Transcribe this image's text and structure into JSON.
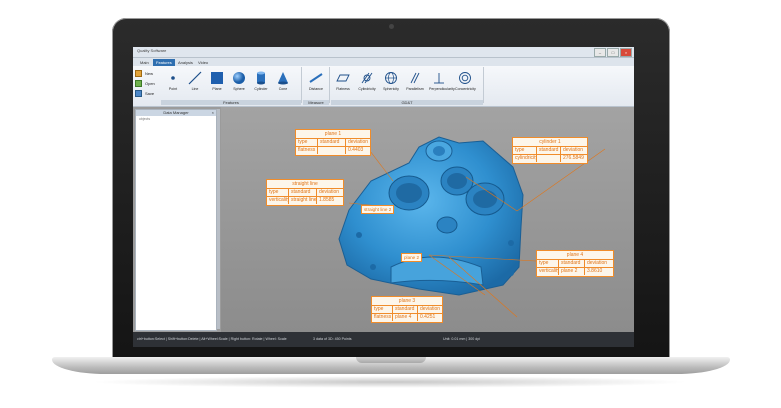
{
  "app": {
    "title": "Quality Software"
  },
  "tabs": [
    {
      "label": "Main"
    },
    {
      "label": "Features"
    },
    {
      "label": "Analysis"
    },
    {
      "label": "Video"
    }
  ],
  "file_menu": [
    {
      "label": "New"
    },
    {
      "label": "Open"
    },
    {
      "label": "Save"
    }
  ],
  "ribbon": {
    "features": {
      "label": "Features",
      "buttons": [
        {
          "label": "Point"
        },
        {
          "label": "Line"
        },
        {
          "label": "Plane"
        },
        {
          "label": "Sphere"
        },
        {
          "label": "Cylinder"
        },
        {
          "label": "Cone"
        }
      ]
    },
    "measure": {
      "label": "Measure",
      "buttons": [
        {
          "label": "Distance"
        }
      ]
    },
    "gdt": {
      "label": "GD&T",
      "buttons": [
        {
          "label": "Flatness"
        },
        {
          "label": "Cylindricity"
        },
        {
          "label": "Sphericity"
        },
        {
          "label": "Parallelism"
        },
        {
          "label": "Perpendicularity"
        },
        {
          "label": "Concentricity"
        }
      ]
    }
  },
  "panel": {
    "title": "Data Manager",
    "subtitle": "objects"
  },
  "status": {
    "left": "ctrl+button:Select | Shift+button:Delete | Alt+Wheel:Scale | Right button: Rotate | Wheel: Scale",
    "middle": "3 data of 3D: 450 Points",
    "right": "Unit: 0.01 mm | 300 dpi"
  },
  "annotations": {
    "plane1": {
      "title": "plane 1",
      "rows": [
        [
          "type",
          "standard",
          "deviation"
        ],
        [
          "flatness",
          "",
          "0.4403"
        ]
      ]
    },
    "cylinder1": {
      "title": "cylinder 1",
      "rows": [
        [
          "type",
          "standard",
          "deviation"
        ],
        [
          "cylindricity",
          "",
          "276.5849"
        ]
      ]
    },
    "straight_line": {
      "title": "straight line",
      "rows": [
        [
          "type",
          "standard",
          "deviation"
        ],
        [
          "verticality",
          "straight line 2",
          "1.8585"
        ]
      ]
    },
    "plane4": {
      "title": "plane 4",
      "rows": [
        [
          "type",
          "standard",
          "deviation"
        ],
        [
          "verticality",
          "plane 2",
          "3.8610"
        ]
      ]
    },
    "plane3": {
      "title": "plane 3",
      "rows": [
        [
          "type",
          "standard",
          "deviation"
        ],
        [
          "flatness",
          "plane 4",
          "0.4251"
        ]
      ]
    }
  },
  "tags": {
    "straight_line_2": "straight line 2",
    "plane_2": "plane 2"
  },
  "colors": {
    "annotation": "#f08c2a",
    "part": "#2e8fcf",
    "viewport": "#9a9a9a"
  }
}
